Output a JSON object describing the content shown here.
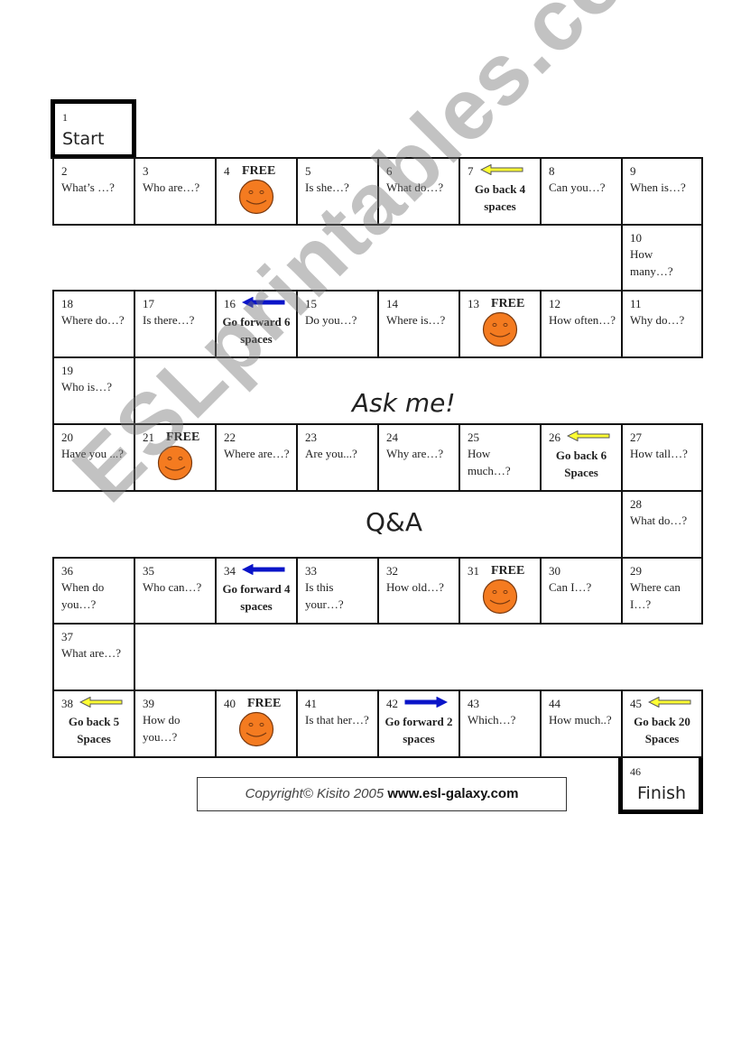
{
  "board": {
    "start": {
      "number": "1",
      "label": "Start"
    },
    "finish": {
      "number": "46",
      "label": "Finish"
    },
    "center_labels": [
      "Ask me!",
      "Q&A"
    ],
    "copyright": {
      "prefix": "Copyright© Kisito 2005",
      "site": "www.esl-galaxy.com"
    },
    "watermark": "ESLprintables.com",
    "colors": {
      "smiley": "#f47b20",
      "yellow_arrow": "#ffff33",
      "blue_arrow": "#0a14c8"
    },
    "squares": [
      {
        "n": "2",
        "text": "What’s …?"
      },
      {
        "n": "3",
        "text": "Who are…?"
      },
      {
        "n": "4",
        "free": "FREE"
      },
      {
        "n": "5",
        "text": "Is she…?"
      },
      {
        "n": "6",
        "text": "What do…?"
      },
      {
        "n": "7",
        "action": "Go back 4 spaces",
        "arrow": "yellow-left"
      },
      {
        "n": "8",
        "text": "Can   you…?"
      },
      {
        "n": "9",
        "text": "When is…?"
      },
      {
        "n": "10",
        "text": "How many…?"
      },
      {
        "n": "11",
        "text": "Why do…?"
      },
      {
        "n": "12",
        "text": "How often…?"
      },
      {
        "n": "13",
        "free": "FREE"
      },
      {
        "n": "14",
        "text": "Where is…?"
      },
      {
        "n": "15",
        "text": "Do you…?"
      },
      {
        "n": "16",
        "action": "Go forward 6 spaces",
        "arrow": "blue-left"
      },
      {
        "n": "17",
        "text": "Is there…?"
      },
      {
        "n": "18",
        "text": "Where do…?"
      },
      {
        "n": "19",
        "text": "Who is…?"
      },
      {
        "n": "20",
        "text": "Have you ...?"
      },
      {
        "n": "21",
        "free": "FREE"
      },
      {
        "n": "22",
        "text": "Where are…?"
      },
      {
        "n": "23",
        "text": "Are you...?"
      },
      {
        "n": "24",
        "text": "Why are…?"
      },
      {
        "n": "25",
        "text": "How much…?"
      },
      {
        "n": "26",
        "action": "Go back 6 Spaces",
        "arrow": "yellow-left"
      },
      {
        "n": "27",
        "text": "How tall…?"
      },
      {
        "n": "28",
        "text": "What do…?"
      },
      {
        "n": "29",
        "text": "Where can I…?"
      },
      {
        "n": "30",
        "text": "Can I…?"
      },
      {
        "n": "31",
        "free": "FREE"
      },
      {
        "n": "32",
        "text": "How old…?"
      },
      {
        "n": "33",
        "text": "Is this your…?"
      },
      {
        "n": "34",
        "action": "Go forward 4 spaces",
        "arrow": "blue-left"
      },
      {
        "n": "35",
        "text": "Who can…?"
      },
      {
        "n": "36",
        "text": "When do you…?"
      },
      {
        "n": "37",
        "text": "What are…?"
      },
      {
        "n": "38",
        "action": "Go back 5 Spaces",
        "arrow": "yellow-left"
      },
      {
        "n": "39",
        "text": "How do you…?"
      },
      {
        "n": "40",
        "free": "FREE"
      },
      {
        "n": "41",
        "text": "Is that her…?"
      },
      {
        "n": "42",
        "action": "Go forward 2 spaces",
        "arrow": "blue-right"
      },
      {
        "n": "43",
        "text": "Which…?"
      },
      {
        "n": "44",
        "text": "How much..?"
      },
      {
        "n": "45",
        "action": "Go back 20 Spaces",
        "arrow": "yellow-left"
      }
    ]
  }
}
